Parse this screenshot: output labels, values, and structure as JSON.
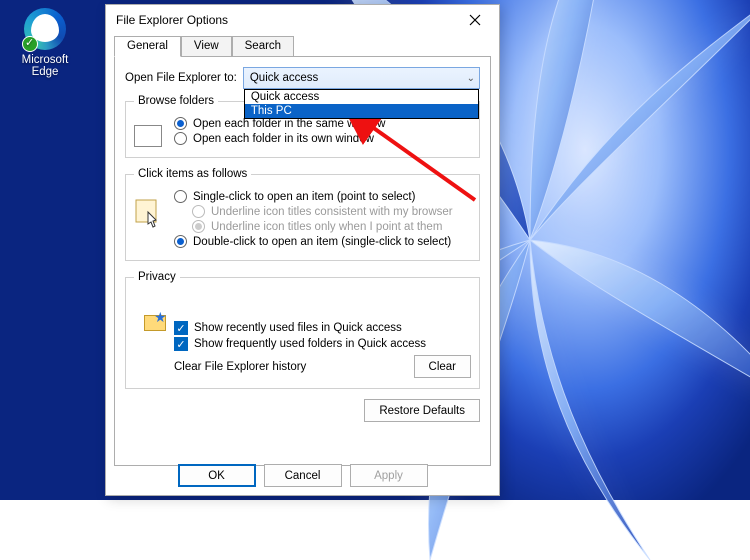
{
  "desktop": {
    "edge_label": "Microsoft\nEdge"
  },
  "dialog": {
    "title": "File Explorer Options",
    "tabs": {
      "general": "General",
      "view": "View",
      "search": "Search"
    },
    "open_label": "Open File Explorer to:",
    "combo_value": "Quick access",
    "combo_options": {
      "quick": "Quick access",
      "thispc": "This PC"
    },
    "browse": {
      "legend": "Browse folders",
      "same": "Open each folder in the same window",
      "own": "Open each folder in its own window"
    },
    "click": {
      "legend": "Click items as follows",
      "single": "Single-click to open an item (point to select)",
      "u_browser": "Underline icon titles consistent with my browser",
      "u_point": "Underline icon titles only when I point at them",
      "double": "Double-click to open an item (single-click to select)"
    },
    "privacy": {
      "legend": "Privacy",
      "recent": "Show recently used files in Quick access",
      "frequent": "Show frequently used folders in Quick access",
      "clear_label": "Clear File Explorer history",
      "clear_btn": "Clear"
    },
    "restore": "Restore Defaults",
    "ok": "OK",
    "cancel": "Cancel",
    "apply": "Apply"
  }
}
